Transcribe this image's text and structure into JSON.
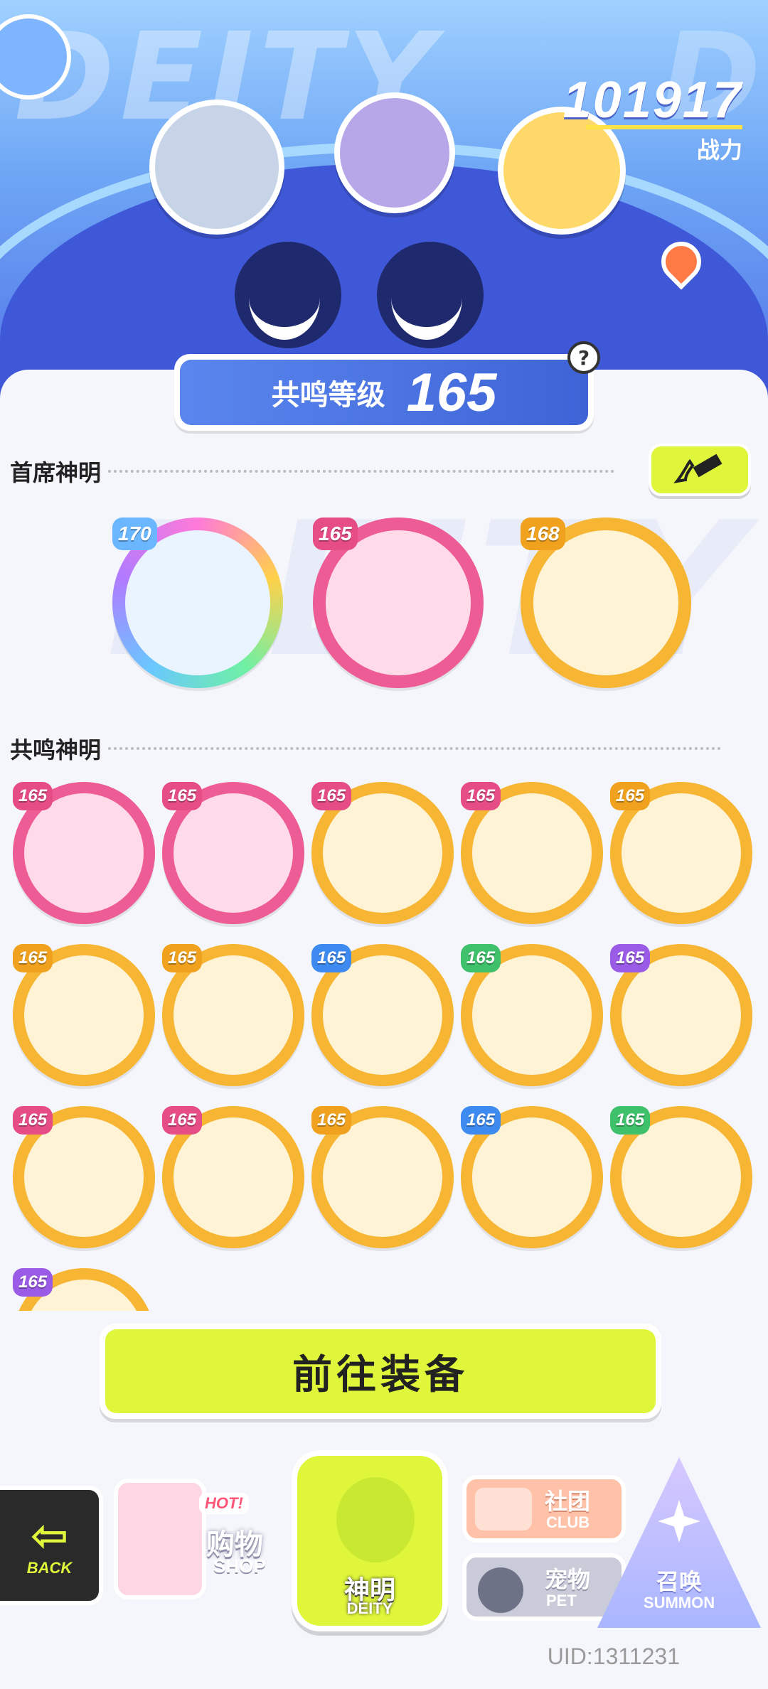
{
  "header": {
    "combat_power_value": "101917",
    "combat_power_label": "战力"
  },
  "resonance": {
    "label": "共鸣等级",
    "value": "165",
    "help_symbol": "?"
  },
  "sections": {
    "chief_deities_title": "首席神明",
    "resonance_deities_title": "共鸣神明"
  },
  "chief_deities": [
    {
      "level": "170",
      "frame": "rainbow"
    },
    {
      "level": "165",
      "frame": "pink"
    },
    {
      "level": "168",
      "frame": "gold"
    }
  ],
  "resonance_deities": [
    {
      "level": "165",
      "frame": "pink"
    },
    {
      "level": "165",
      "frame": "pink"
    },
    {
      "level": "165",
      "frame": "gold"
    },
    {
      "level": "165",
      "frame": "gold"
    },
    {
      "level": "165",
      "frame": "gold"
    },
    {
      "level": "165",
      "frame": "gold"
    },
    {
      "level": "165",
      "frame": "gold"
    },
    {
      "level": "165",
      "frame": "gold"
    },
    {
      "level": "165",
      "frame": "gold"
    },
    {
      "level": "165",
      "frame": "gold"
    },
    {
      "level": "165",
      "frame": "gold"
    },
    {
      "level": "165",
      "frame": "gold"
    },
    {
      "level": "165",
      "frame": "gold"
    },
    {
      "level": "165",
      "frame": "gold"
    },
    {
      "level": "165",
      "frame": "gold"
    },
    {
      "level": "165",
      "frame": "gold"
    }
  ],
  "equip_button": "前往装备",
  "nav": {
    "back_en": "BACK",
    "shop_hot": "HOT!",
    "shop_cn": "购物",
    "shop_en": "SHOP",
    "deity_cn": "神明",
    "deity_en": "DEITY",
    "club_cn": "社团",
    "club_en": "CLUB",
    "pet_cn": "宠物",
    "pet_en": "PET",
    "summon_cn": "召唤",
    "summon_en": "SUMMON"
  },
  "uid": "UID:1311231",
  "colors": {
    "accent_lime": "#dff63a",
    "frame_pink": "#ee5c96",
    "frame_gold": "#f6b634",
    "hero_blue": "#3f58d8"
  }
}
